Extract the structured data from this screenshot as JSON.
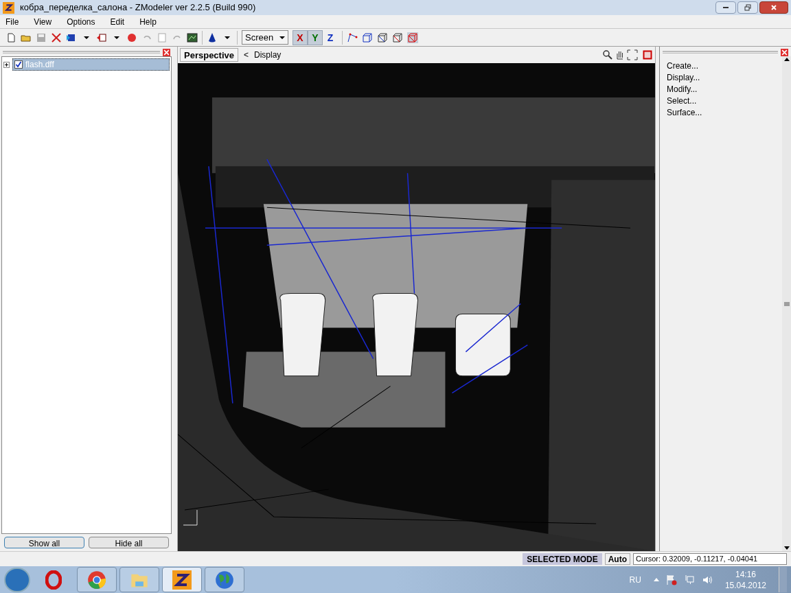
{
  "window": {
    "title": "кобра_переделка_салона - ZModeler ver 2.2.5 (Build 990)"
  },
  "menu": [
    "File",
    "View",
    "Options",
    "Edit",
    "Help"
  ],
  "toolbar": {
    "view_select": "Screen",
    "axes": [
      {
        "label": "X",
        "selected": true
      },
      {
        "label": "Y",
        "selected": true
      },
      {
        "label": "Z",
        "selected": false
      }
    ]
  },
  "scene_tree": {
    "items": [
      {
        "label": "flash.dff",
        "checked": true,
        "selected": true
      }
    ],
    "buttons": [
      "Show all",
      "Hide all"
    ]
  },
  "viewport": {
    "tab": "Perspective",
    "nav_arrow": "<",
    "nav_label": "Display"
  },
  "command_panel": {
    "items": [
      "Create...",
      "Display...",
      "Modify...",
      "Select...",
      "Surface..."
    ]
  },
  "status_bar": {
    "mode": "SELECTED MODE",
    "snap": "Auto",
    "cursor": "Cursor: 0.32009, -0.11217, -0.04041"
  },
  "taskbar": {
    "language": "RU",
    "time": "14:16",
    "date": "15.04.2012"
  }
}
